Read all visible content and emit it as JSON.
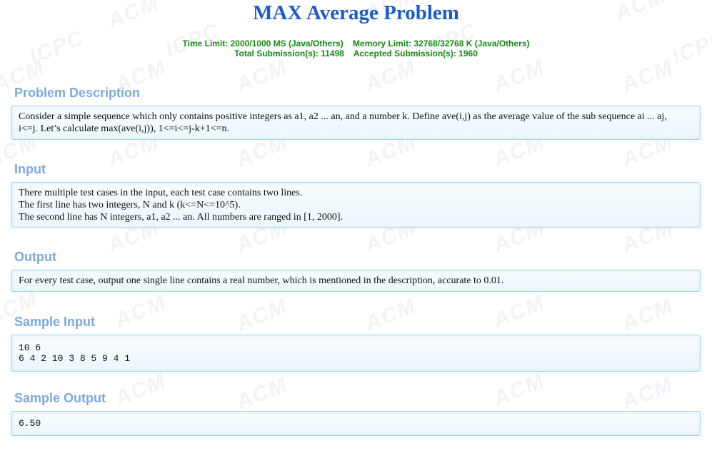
{
  "watermarks": [
    "ACM",
    "ICPC"
  ],
  "header": {
    "title": "MAX Average Problem",
    "limits_line1": "Time Limit: 2000/1000 MS (Java/Others)    Memory Limit: 32768/32768 K (Java/Others)",
    "limits_line2": "Total Submission(s): 11498    Accepted Submission(s): 1960"
  },
  "sections": {
    "description": {
      "title": "Problem Description",
      "lines": [
        "Consider a simple sequence which only contains positive integers as a1, a2 ... an, and a number k. Define ave(i,j) as the average value of the sub sequence ai ... aj,",
        "i<=j. Let’s calculate max(ave(i,j)), 1<=i<=j-k+1<=n."
      ]
    },
    "input": {
      "title": "Input",
      "lines": [
        "There multiple test cases in the input, each test case contains two lines.",
        "The first line has two integers, N and k (k<=N<=10^5).",
        "The second line has N integers, a1, a2 ... an. All numbers are ranged in [1, 2000]."
      ]
    },
    "output": {
      "title": "Output",
      "lines": [
        "For every test case, output one single line contains a real number, which is mentioned in the description, accurate to 0.01."
      ]
    },
    "sample_input": {
      "title": "Sample Input",
      "lines": [
        "10 6",
        "6 4 2 10 3 8 5 9 4 1"
      ]
    },
    "sample_output": {
      "title": "Sample Output",
      "lines": [
        "6.50"
      ]
    }
  },
  "colors": {
    "title": "#1a5cc8",
    "limits": "#138a13",
    "section_title": "#7ca9de",
    "panel_border": "#9fd3f0"
  }
}
